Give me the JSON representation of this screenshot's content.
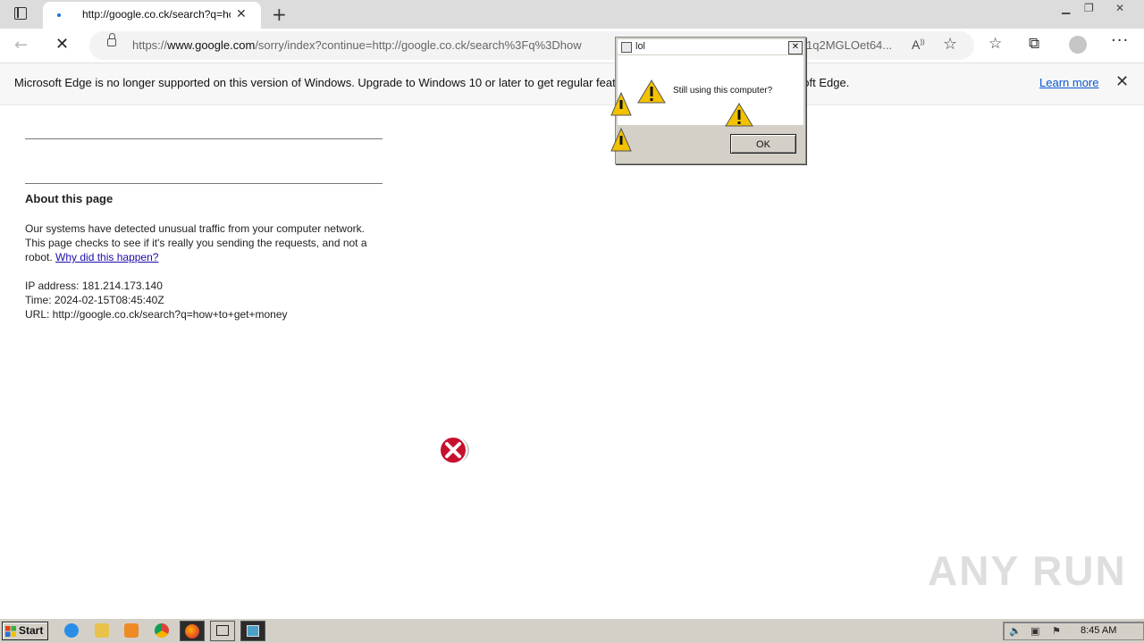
{
  "browser": {
    "tab": {
      "title": "http://google.co.ck/search?q=how+to+get+money"
    },
    "url": {
      "scheme": "https://",
      "host": "www.google.com",
      "path_visible": "/sorry/index?continue=http://google.co.ck/search%3Fq%3Dhow",
      "tail_visible": "1q2MGLOet64..."
    }
  },
  "infobar": {
    "message": "Microsoft Edge is no longer supported on this version of Windows. Upgrade to Windows 10 or later to get regular features and security updates for Microsoft Edge.",
    "learn_more": "Learn more"
  },
  "page": {
    "about_title": "About this page",
    "paragraph": "Our systems have detected unusual traffic from your computer network. This page checks to see if it's really you sending the requests, and not a robot.",
    "why_link": "Why did this happen?",
    "ip_line": "IP address: 181.214.173.140",
    "time_line": "Time: 2024-02-15T08:45:40Z",
    "url_line": "URL: http://google.co.ck/search?q=how+to+get+money"
  },
  "dialog": {
    "title": "lol",
    "message": "Still using this computer?",
    "ok_label": "OK",
    "close_glyph": "✕"
  },
  "taskbar": {
    "start_label": "Start",
    "clock": "8:45 AM"
  },
  "watermark": {
    "text": "ANY RUN"
  },
  "icons": {
    "back": "back-arrow-icon",
    "stop": "stop-loading-icon",
    "lock": "lock-icon",
    "read_aloud": "read-aloud-icon",
    "add_favorite": "add-favorite-icon",
    "favorites": "favorites-icon",
    "collections": "collections-icon",
    "profile": "profile-avatar",
    "more": "more-menu-icon",
    "warning": "warning-icon",
    "error": "error-icon"
  },
  "colors": {
    "link": "#1a0dab",
    "edge_link": "#0b57d0",
    "tab_dot": "#1a73e8",
    "warning_yellow": "#f2c200",
    "error_red": "#c8102e"
  }
}
